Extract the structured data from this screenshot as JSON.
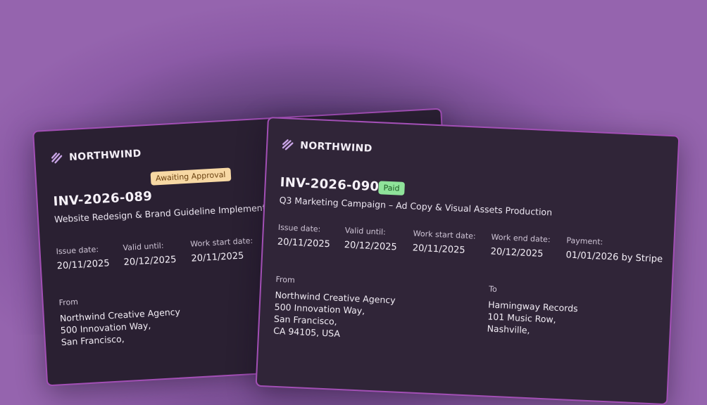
{
  "brand": {
    "name": "NORTHWIND"
  },
  "back_invoice": {
    "number": "INV-2026-089",
    "status": "Awaiting Approval",
    "title": "Website Redesign & Brand Guideline Implementation",
    "fields": [
      {
        "label": "Issue date:",
        "value": "20/11/2025"
      },
      {
        "label": "Valid until:",
        "value": "20/12/2025"
      },
      {
        "label": "Work start date:",
        "value": "20/11/2025"
      }
    ],
    "from": {
      "label": "From",
      "lines": [
        "Northwind Creative Agency",
        "500 Innovation Way,",
        "San Francisco,"
      ]
    }
  },
  "front_invoice": {
    "number": "INV-2026-090",
    "status": "Paid",
    "title": "Q3 Marketing Campaign – Ad Copy & Visual Assets Production",
    "fields": [
      {
        "label": "Issue date:",
        "value": "20/11/2025"
      },
      {
        "label": "Valid until:",
        "value": "20/12/2025"
      },
      {
        "label": "Work start date:",
        "value": "20/11/2025"
      },
      {
        "label": "Work end date:",
        "value": "20/12/2025"
      },
      {
        "label": "Payment:",
        "value": "01/01/2026 by Stripe"
      }
    ],
    "from": {
      "label": "From",
      "lines": [
        "Northwind Creative Agency",
        "500 Innovation Way,",
        "San Francisco,",
        "CA 94105, USA"
      ]
    },
    "to": {
      "label": "To",
      "lines": [
        "Hamingway Records",
        "101 Music Row,",
        "Nashville,"
      ]
    }
  }
}
